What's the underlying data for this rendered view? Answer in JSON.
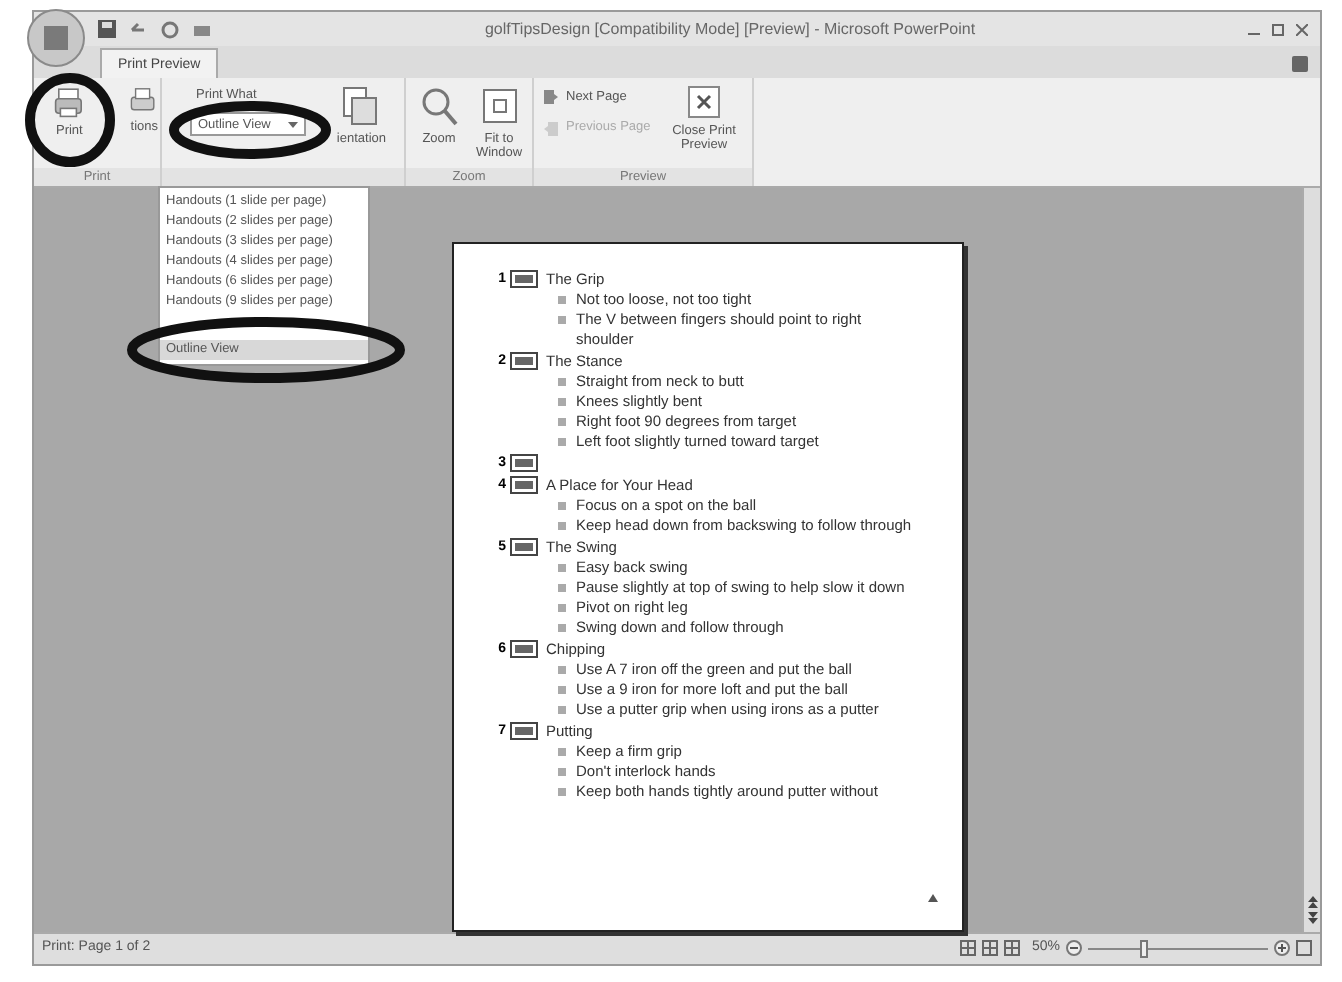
{
  "window": {
    "title": "golfTipsDesign [Compatibility Mode] [Preview] - Microsoft PowerPoint"
  },
  "tabs": [
    {
      "label": "Print Preview",
      "selected": true
    }
  ],
  "ribbon": {
    "print_group": {
      "label": "Print",
      "buttons": [
        {
          "label": "Print",
          "kind": "print"
        },
        {
          "label": "tions",
          "kind": "options"
        }
      ]
    },
    "page_setup": {
      "print_what_label": "Print What",
      "print_what_value": "Outline View",
      "orientation_label": "ientation"
    },
    "zoom_group": {
      "label": "Zoom",
      "buttons": [
        {
          "label": "Zoom",
          "kind": "zoom"
        },
        {
          "label": "Fit to Window",
          "kind": "fit"
        }
      ]
    },
    "preview_group": {
      "label": "Preview",
      "buttons": [
        {
          "label": "Next Page",
          "kind": "next",
          "disabled": false
        },
        {
          "label": "Previous Page",
          "kind": "previous",
          "disabled": true
        }
      ],
      "close": {
        "label": "Close Print Preview"
      }
    }
  },
  "dropdown_menu": {
    "items": [
      {
        "label": "Handouts (1 slide per page)",
        "selected": false
      },
      {
        "label": "Handouts (2 slides per page)",
        "selected": false
      },
      {
        "label": "Handouts (3 slides per page)",
        "selected": false
      },
      {
        "label": "Handouts (4 slides per page)",
        "selected": false
      },
      {
        "label": "Handouts (6 slides per page)",
        "selected": false
      },
      {
        "label": "Handouts (9 slides per page)",
        "selected": false
      },
      {
        "label": "Outline View",
        "selected": true
      }
    ]
  },
  "outline": {
    "slides": [
      {
        "number": "1",
        "title": "The Grip",
        "bullets": [
          "Not too loose, not too tight",
          "The V between fingers should point to right shoulder"
        ]
      },
      {
        "number": "2",
        "title": "The Stance",
        "bullets": [
          "Straight from neck to butt",
          "Knees slightly bent",
          "Right foot 90 degrees from target",
          "Left foot slightly turned toward target"
        ]
      },
      {
        "number": "3"
      },
      {
        "number": "4",
        "title": "A Place for Your Head",
        "bullets": [
          "Focus on a spot on the ball",
          "Keep head down from backswing to follow through"
        ]
      },
      {
        "number": "5",
        "title": "The Swing",
        "bullets": [
          "Easy back swing",
          "Pause slightly at top of swing to help slow it down",
          "Pivot on right leg",
          "Swing down and follow through"
        ]
      },
      {
        "number": "6",
        "title": "Chipping",
        "bullets": [
          "Use A 7 iron off the green and put the ball",
          "Use a 9 iron for more loft and put the ball",
          "Use a putter grip when using irons as a putter"
        ]
      },
      {
        "number": "7",
        "title": "Putting",
        "bullets": [
          "Keep a firm grip",
          "Don't interlock hands",
          "Keep both hands tightly around putter without"
        ]
      }
    ]
  },
  "status_bar": {
    "text": "Print: Page 1 of 2",
    "zoom": "50%",
    "zoom_slider": {
      "level": 0.3
    }
  }
}
